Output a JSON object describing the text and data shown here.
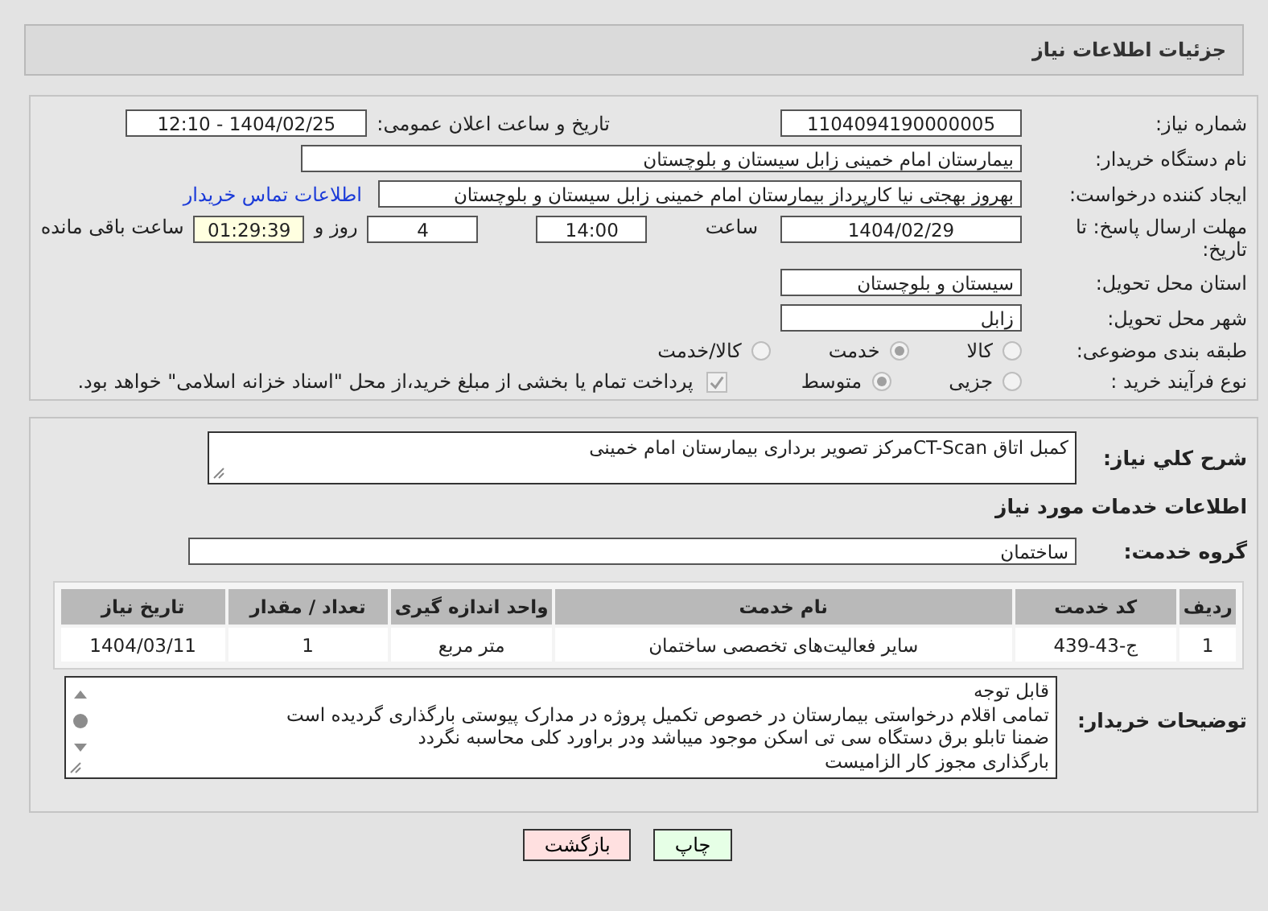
{
  "header": {
    "title": "جزئیات اطلاعات نیاز"
  },
  "info": {
    "need_number": {
      "label": "شماره نیاز:",
      "value": "1104094190000005"
    },
    "announce": {
      "label": "تاریخ و ساعت اعلان عمومی:",
      "value": "1404/02/25 - 12:10"
    },
    "buyer_org": {
      "label": "نام دستگاه خریدار:",
      "value": "بیمارستان امام خمینی زابل سیستان و بلوچستان"
    },
    "requester": {
      "label": "ایجاد کننده درخواست:",
      "value": "بهروز بهجتی نیا کارپرداز بیمارستان امام خمینی زابل سیستان و بلوچستان",
      "link": "اطلاعات تماس خریدار"
    },
    "deadline": {
      "label": "مهلت ارسال پاسخ: تا تاریخ:",
      "date": "1404/02/29",
      "time_label": "ساعت",
      "time": "14:00",
      "days": "4",
      "days_label": "روز و",
      "remaining": "01:29:39",
      "remaining_label": "ساعت باقی مانده"
    },
    "province": {
      "label": "استان محل تحویل:",
      "value": "سیستان و بلوچستان"
    },
    "city": {
      "label": "شهر محل تحویل:",
      "value": "زابل"
    },
    "category": {
      "label": "طبقه بندی موضوعی:",
      "disabled": true,
      "options": [
        {
          "label": "کالا",
          "selected": false
        },
        {
          "label": "خدمت",
          "selected": true
        },
        {
          "label": "کالا/خدمت",
          "selected": false
        }
      ]
    },
    "process": {
      "label": "نوع فرآیند خرید :",
      "disabled": true,
      "options": [
        {
          "label": "جزیی",
          "selected": false
        },
        {
          "label": "متوسط",
          "selected": true
        }
      ],
      "payment": {
        "label": "پرداخت تمام یا بخشی از مبلغ خرید،از محل \"اسناد خزانه اسلامی\" خواهد بود.",
        "checked": true
      }
    }
  },
  "details": {
    "summary": {
      "label": "شرح کلي نياز:",
      "value": "کمبل اتاق CT-Scanمرکز تصویر برداری بیمارستان امام خمینی"
    },
    "services_heading": "اطلاعات خدمات مورد نیاز",
    "service_group": {
      "label": "گروه خدمت:",
      "value": "ساختمان"
    },
    "table": {
      "columns": [
        "ردیف",
        "کد خدمت",
        "نام خدمت",
        "واحد اندازه گیری",
        "تعداد / مقدار",
        "تاریخ نیاز"
      ],
      "rows": [
        [
          "1",
          "ج-43-439",
          "سایر فعالیت‌های تخصصی ساختمان",
          "متر مربع",
          "1",
          "1404/03/11"
        ]
      ]
    },
    "notes": {
      "label": "توضیحات خریدار:",
      "lines": [
        "قابل توجه",
        "تمامی اقلام درخواستی بیمارستان در خصوص تکمیل پروژه در مدارک پیوستی بارگذاری  گردیده است",
        "ضمنا تابلو برق دستگاه سی تی اسکن موجود میباشد ودر براورد کلی محاسبه نگردد",
        "بارگذاری مجوز کار الزامیست"
      ]
    }
  },
  "buttons": [
    {
      "label": "چاپ",
      "kind": "print"
    },
    {
      "label": "بازگشت",
      "kind": "back"
    }
  ]
}
